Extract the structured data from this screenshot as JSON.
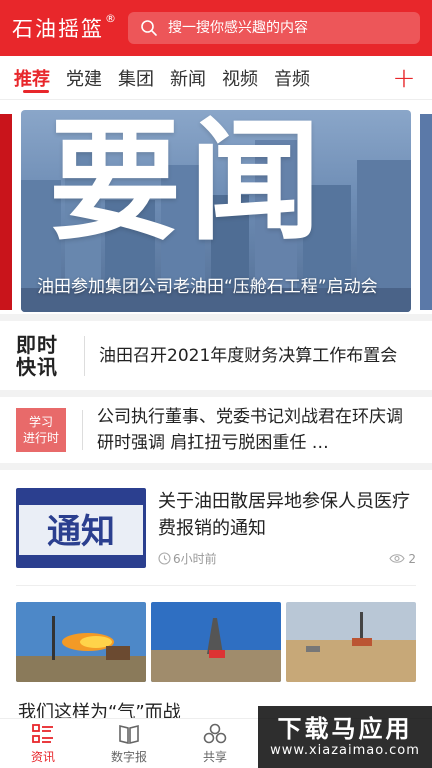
{
  "header": {
    "logo_text": "石油摇篮",
    "logo_mark": "®",
    "search_placeholder": "搜一搜你感兴趣的内容"
  },
  "tabs": {
    "items": [
      "推荐",
      "党建",
      "集团",
      "新闻",
      "视频",
      "音频"
    ],
    "active": "推荐",
    "add_label": "+"
  },
  "banner": {
    "big_text": "要闻",
    "caption": "油田参加集团公司老油田“压舱石工程”启动会"
  },
  "quick_news": {
    "flash_badge": [
      "即时",
      "快讯"
    ],
    "flash_text": "油田召开2021年度财务决算工作布置会",
    "study_badge": [
      "学习",
      "进行时"
    ],
    "study_text": "公司执行董事、党委书记刘战君在环庆调研时强调 肩扛扭亏脱困重任 …"
  },
  "article": {
    "thumb_text": "通知",
    "title": "关于油田散居异地参保人员医疗费报销的通知",
    "time": "6小时前",
    "views": "2"
  },
  "next_article": {
    "title": "我们这样为“气”而战"
  },
  "bottom_nav": {
    "items": [
      {
        "label": "资讯",
        "icon": "news-list-icon"
      },
      {
        "label": "数字报",
        "icon": "digital-paper-icon"
      },
      {
        "label": "共享",
        "icon": "share-cluster-icon"
      }
    ]
  },
  "watermark": {
    "main": "下载马应用",
    "sub": "www.xiazaimao.com"
  },
  "colors": {
    "brand": "#e8272b",
    "notice_blue": "#2b3f8f"
  }
}
